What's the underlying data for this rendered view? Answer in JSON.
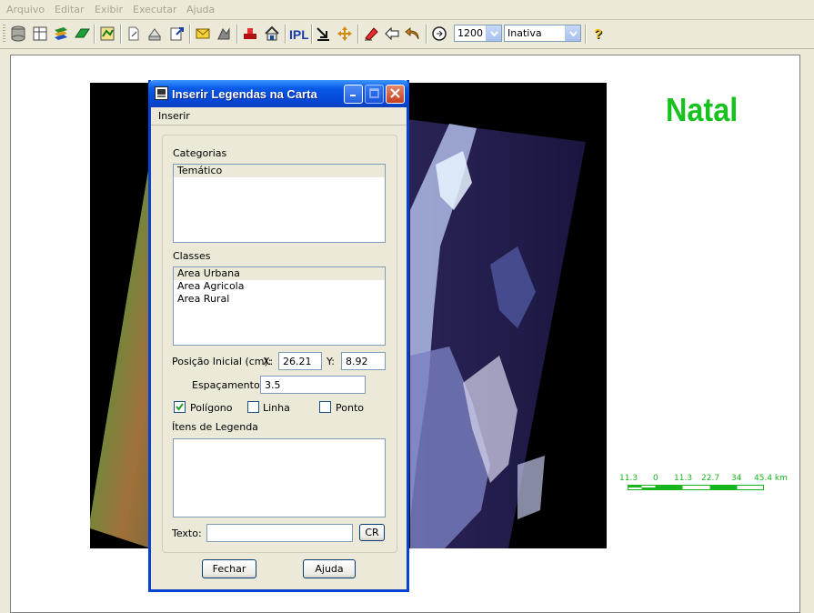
{
  "menu": {
    "items": [
      "Arquivo",
      "Editar",
      "Exibir",
      "Executar",
      "Ajuda"
    ]
  },
  "toolbar": {
    "icons": [
      "database-icon",
      "table-icon",
      "layers-icon",
      "plane-icon",
      "map-icon",
      "new-doc-icon",
      "edit-doc-icon",
      "export-doc-icon",
      "envelope-icon",
      "insert-legend-icon",
      "house-icon",
      "text-ipl-icon",
      "arrow-in-icon",
      "move-icon",
      "eraser-icon",
      "back-arrow-icon",
      "undo-icon",
      "zoom-icon",
      "help-icon"
    ],
    "scale_value": "1200",
    "mode_value": "Inativa"
  },
  "map": {
    "city_label": "Natal",
    "scale_labels": [
      "11.3",
      "0",
      "11.3",
      "22.7",
      "34",
      "45.4 km"
    ]
  },
  "dialog": {
    "title": "Inserir Legendas na Carta",
    "menu": "Inserir",
    "categorias_label": "Categorias",
    "categorias": [
      "Temático"
    ],
    "classes_label": "Classes",
    "classes": [
      "Area Urbana",
      "Area Agricola",
      "Area Rural"
    ],
    "posicao_label": "Posição Inicial (cm):",
    "x_label": "X:",
    "x_value": "26.21",
    "y_label": "Y:",
    "y_value": "8.92",
    "espacamento_label": "Espaçamento:",
    "espacamento_value": "3.5",
    "poligono_label": "Polígono",
    "poligono_checked": true,
    "linha_label": "Linha",
    "linha_checked": false,
    "ponto_label": "Ponto",
    "ponto_checked": false,
    "itens_label": "Ítens de Legenda",
    "texto_label": "Texto:",
    "texto_value": "",
    "cr_label": "CR",
    "fechar_label": "Fechar",
    "ajuda_label": "Ajuda"
  },
  "colors": {
    "accent": "#0842cf",
    "city": "#18c21e",
    "scale": "#19b51f"
  }
}
